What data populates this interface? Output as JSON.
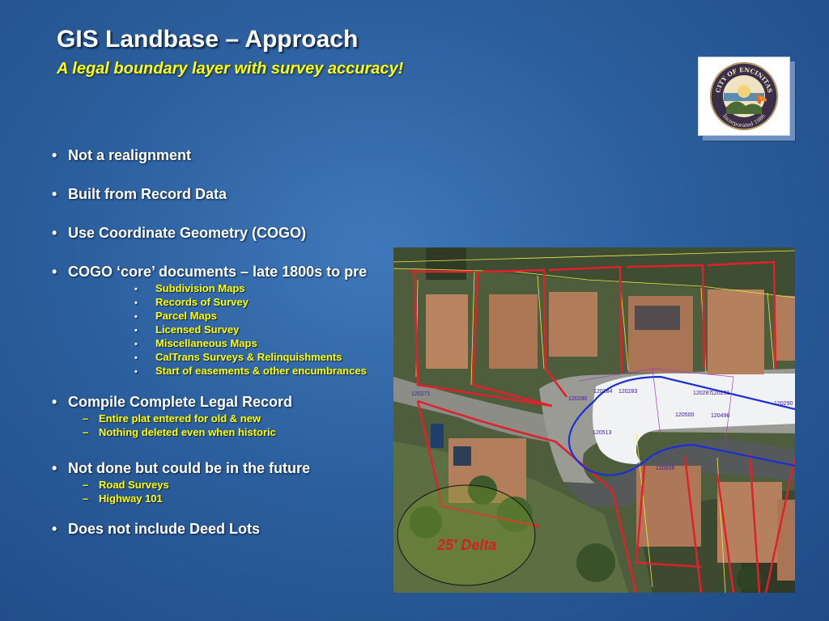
{
  "slide": {
    "title": "GIS Landbase – Approach",
    "subtitle": "A legal boundary layer with survey accuracy!"
  },
  "seal": {
    "icon": "city-of-encinitas-seal",
    "text_top": "CITY OF ENCINITAS",
    "text_bottom": "Incorporated 1986"
  },
  "bullets": [
    {
      "text": "Not a realignment"
    },
    {
      "text": "Built from Record Data"
    },
    {
      "text": "Use Coordinate Geometry (COGO)"
    },
    {
      "text": "COGO ‘core’ documents – late 1800s to pre",
      "sub": [
        "Subdivision Maps",
        "Records of Survey",
        "Parcel Maps",
        "Licensed Survey",
        "Miscellaneous Maps",
        "CalTrans Surveys & Relinquishments",
        "Start of easements & other encumbrances"
      ]
    },
    {
      "text": "Compile Complete Legal Record",
      "sub": [
        "Entire plat entered for old & new",
        "Nothing deleted even when historic"
      ]
    },
    {
      "text": "Not done but could be in the future",
      "sub": [
        "Road Surveys",
        "Highway 101"
      ]
    },
    {
      "text": "Does not include Deed Lots"
    }
  ],
  "markers": {
    "level1": "•",
    "level2": "•",
    "dash": "–"
  },
  "aerial": {
    "delta_label": "25' Delta",
    "parcel_numbers": [
      "120284",
      "120283",
      "120287",
      "120291",
      "120290",
      "120280",
      "120500",
      "120496",
      "120513",
      "120271",
      "120026"
    ]
  },
  "colors": {
    "background": "#2c5f9e",
    "title": "#ffffff",
    "subtitle": "#ffff00",
    "sub_bullets": "#ffff00",
    "parcel_red": "#e0202a",
    "row_blue": "#1a2fd8",
    "delta_label": "#d81f1f"
  }
}
